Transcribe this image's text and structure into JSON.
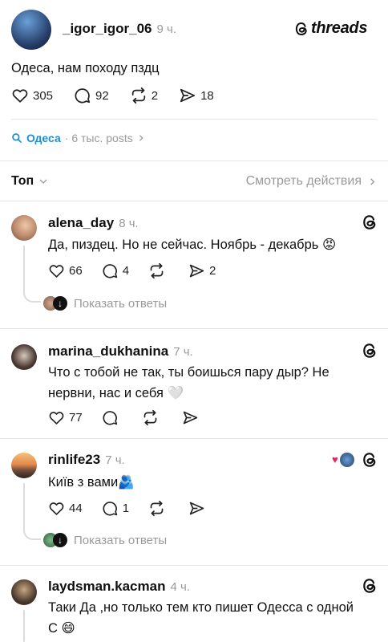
{
  "post": {
    "username": "_igor_igor_06",
    "time": "9 ч.",
    "brand": "threads",
    "text": "Одеса, нам походу пздц",
    "likes": "305",
    "comments": "92",
    "reposts": "2",
    "shares": "18"
  },
  "topic": {
    "name": "Одеса",
    "meta": "· 6 тыс. posts"
  },
  "sort": {
    "label": "Топ",
    "activity_link": "Смотреть действия"
  },
  "replies": [
    {
      "username": "alena_day",
      "time": "8 ч.",
      "text": "Да, пиздец. Но не сейчас. Ноябрь - декабрь 😡",
      "likes": "66",
      "comments": "4",
      "reposts": "",
      "shares": "2",
      "show_replies": "Показать ответы"
    },
    {
      "username": "marina_dukhanina",
      "time": "7 ч.",
      "text_line1": "Что с тобой не так, ты боишься пару дыр? Не",
      "text_line2": "нервни, нас и себя 🤍",
      "likes": "77",
      "comments": "",
      "reposts": "",
      "shares": ""
    },
    {
      "username": "rinlife23",
      "time": "7 ч.",
      "text": "Київ з вами🫂",
      "likes": "44",
      "comments": "1",
      "reposts": "",
      "shares": "",
      "show_replies": "Показать ответы"
    },
    {
      "username": "laydsman.kacman",
      "time": "4 ч.",
      "text_line1": "Таки Да ,но только тем кто пишет Одесса с одной",
      "text_line2": "С 😄"
    }
  ],
  "colors": {
    "link_blue": "#1d8fd6",
    "muted": "#9a9a9a",
    "divider": "#e5e5e5"
  }
}
